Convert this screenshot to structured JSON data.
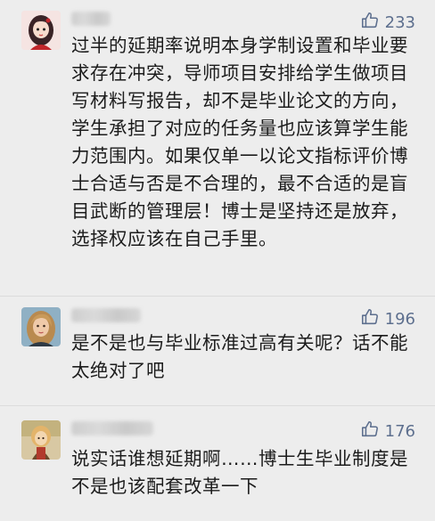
{
  "comments": [
    {
      "likes": "233",
      "text": "过半的延期率说明本身学制设置和毕业要求存在冲突，导师项目安排给学生做项目写材料写报告，却不是毕业论文的方向，学生承担了对应的任务量也应该算学生能力范围内。如果仅单一以论文指标评价博士合适与否是不合理的，最不合适的是盲目武断的管理层！博士是坚持还是放弃，选择权应该在自己手里。"
    },
    {
      "likes": "196",
      "text": "是不是也与毕业标准过高有关呢？话不能太绝对了吧"
    },
    {
      "likes": "176",
      "text": "说实话谁想延期啊……博士生毕业制度是不是也该配套改革一下"
    }
  ],
  "colors": {
    "accent": "#5d6f8e",
    "background": "#ededed",
    "text": "#1c1c1c"
  },
  "icons": {
    "like": "thumbs-up-icon"
  }
}
